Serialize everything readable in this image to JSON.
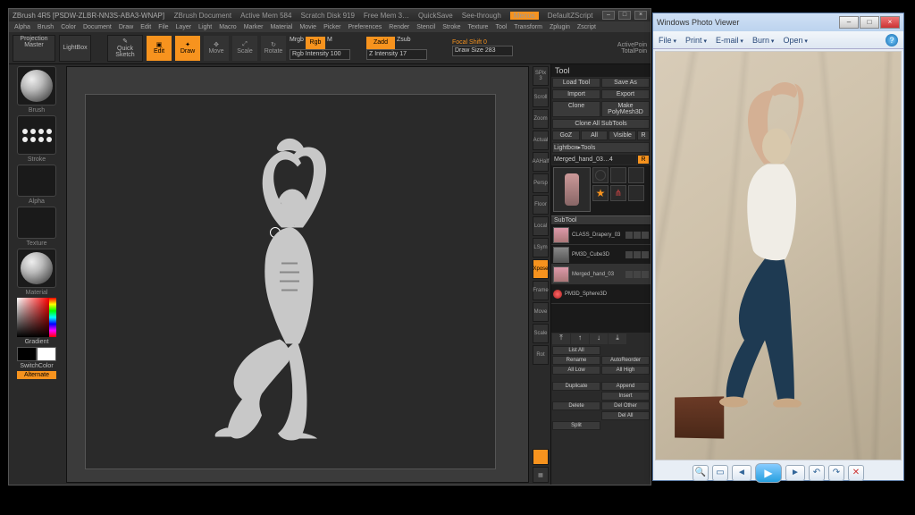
{
  "zbrush": {
    "title": "ZBrush 4R5 [PSDW-ZLBR-NN3S-ABA3-WNAP]",
    "doc_name": "ZBrush Document",
    "active_mem": "Active Mem 584",
    "scratch": "Scratch Disk 919",
    "free_mem": "Free Mem 3…",
    "quicksave": "QuickSave",
    "seethrough": "See-through",
    "menus_tag": "Menus",
    "script": "DefaultZScript",
    "menu": [
      "Alpha",
      "Brush",
      "Color",
      "Document",
      "Draw",
      "Edit",
      "File",
      "Layer",
      "Light",
      "Macro",
      "Marker",
      "Material",
      "Movie",
      "Picker",
      "Preferences",
      "Render",
      "Stencil",
      "Stroke",
      "Texture",
      "Tool",
      "Transform",
      "Zplugin",
      "Zscript"
    ],
    "shelf": {
      "projection_master": "Projection Master",
      "lightbox": "LightBox",
      "quick_sketch": "Quick Sketch",
      "edit": "Edit",
      "draw": "Draw",
      "move": "Move",
      "scale": "Scale",
      "rotate": "Rotate",
      "mrgb": "Mrgb",
      "rgb": "Rgb",
      "m": "M",
      "rgb_intensity": "Rgb Intensity 100",
      "zadd": "Zadd",
      "zsub": "Zsub",
      "z_intensity": "Z Intensity 17",
      "focal_shift": "Focal Shift 0",
      "draw_size": "Draw Size 283",
      "activepts": "ActivePoin",
      "totalpts": "TotalPoin"
    },
    "left": {
      "brush": "Brush",
      "stroke": "Stroke",
      "alpha": "Alpha",
      "texture": "Texture",
      "material": "Material",
      "gradient": "Gradient",
      "switchcolor": "SwitchColor",
      "alternate": "Alternate"
    },
    "right_pal": [
      "SPix 3",
      "Scroll",
      "Zoom",
      "Actual",
      "AAHalf",
      "Persp",
      "Floor",
      "Local",
      "LSym",
      "Xpose",
      "Frame",
      "Move",
      "Scale",
      "Rot"
    ],
    "tool": {
      "header": "Tool",
      "load": "Load Tool",
      "saveas": "Save As",
      "import": "Import",
      "export": "Export",
      "clone": "Clone",
      "makepm": "Make PolyMesh3D",
      "cloneall": "Clone All SubTools",
      "goz": "GoZ",
      "all": "All",
      "visible": "Visible",
      "r": "R",
      "lightbox_tools": "Lightbox▸Tools",
      "current": "Merged_hand_03…4",
      "quick_items": [
        "Cylinder3D",
        "",
        "SimpleBrush",
        "Extract"
      ],
      "subtool_hdr": "SubTool",
      "subtools": [
        {
          "name": "CLASS_Drapery_03"
        },
        {
          "name": "PM3D_Cube3D"
        },
        {
          "name": "Merged_hand_03"
        },
        {
          "name": "PM3D_Sphere3D"
        }
      ],
      "listall": "List All",
      "rename": "Rename",
      "autoreorder": "AutoReorder",
      "alllow": "All Low",
      "allhigh": "All High",
      "duplicate": "Duplicate",
      "append": "Append",
      "insert": "Insert",
      "delete": "Delete",
      "delother": "Del Other",
      "delall": "Del All",
      "split": "Split"
    }
  },
  "wpv": {
    "title": "Windows Photo Viewer",
    "menu": [
      "File",
      "Print",
      "E-mail",
      "Burn",
      "Open"
    ]
  }
}
